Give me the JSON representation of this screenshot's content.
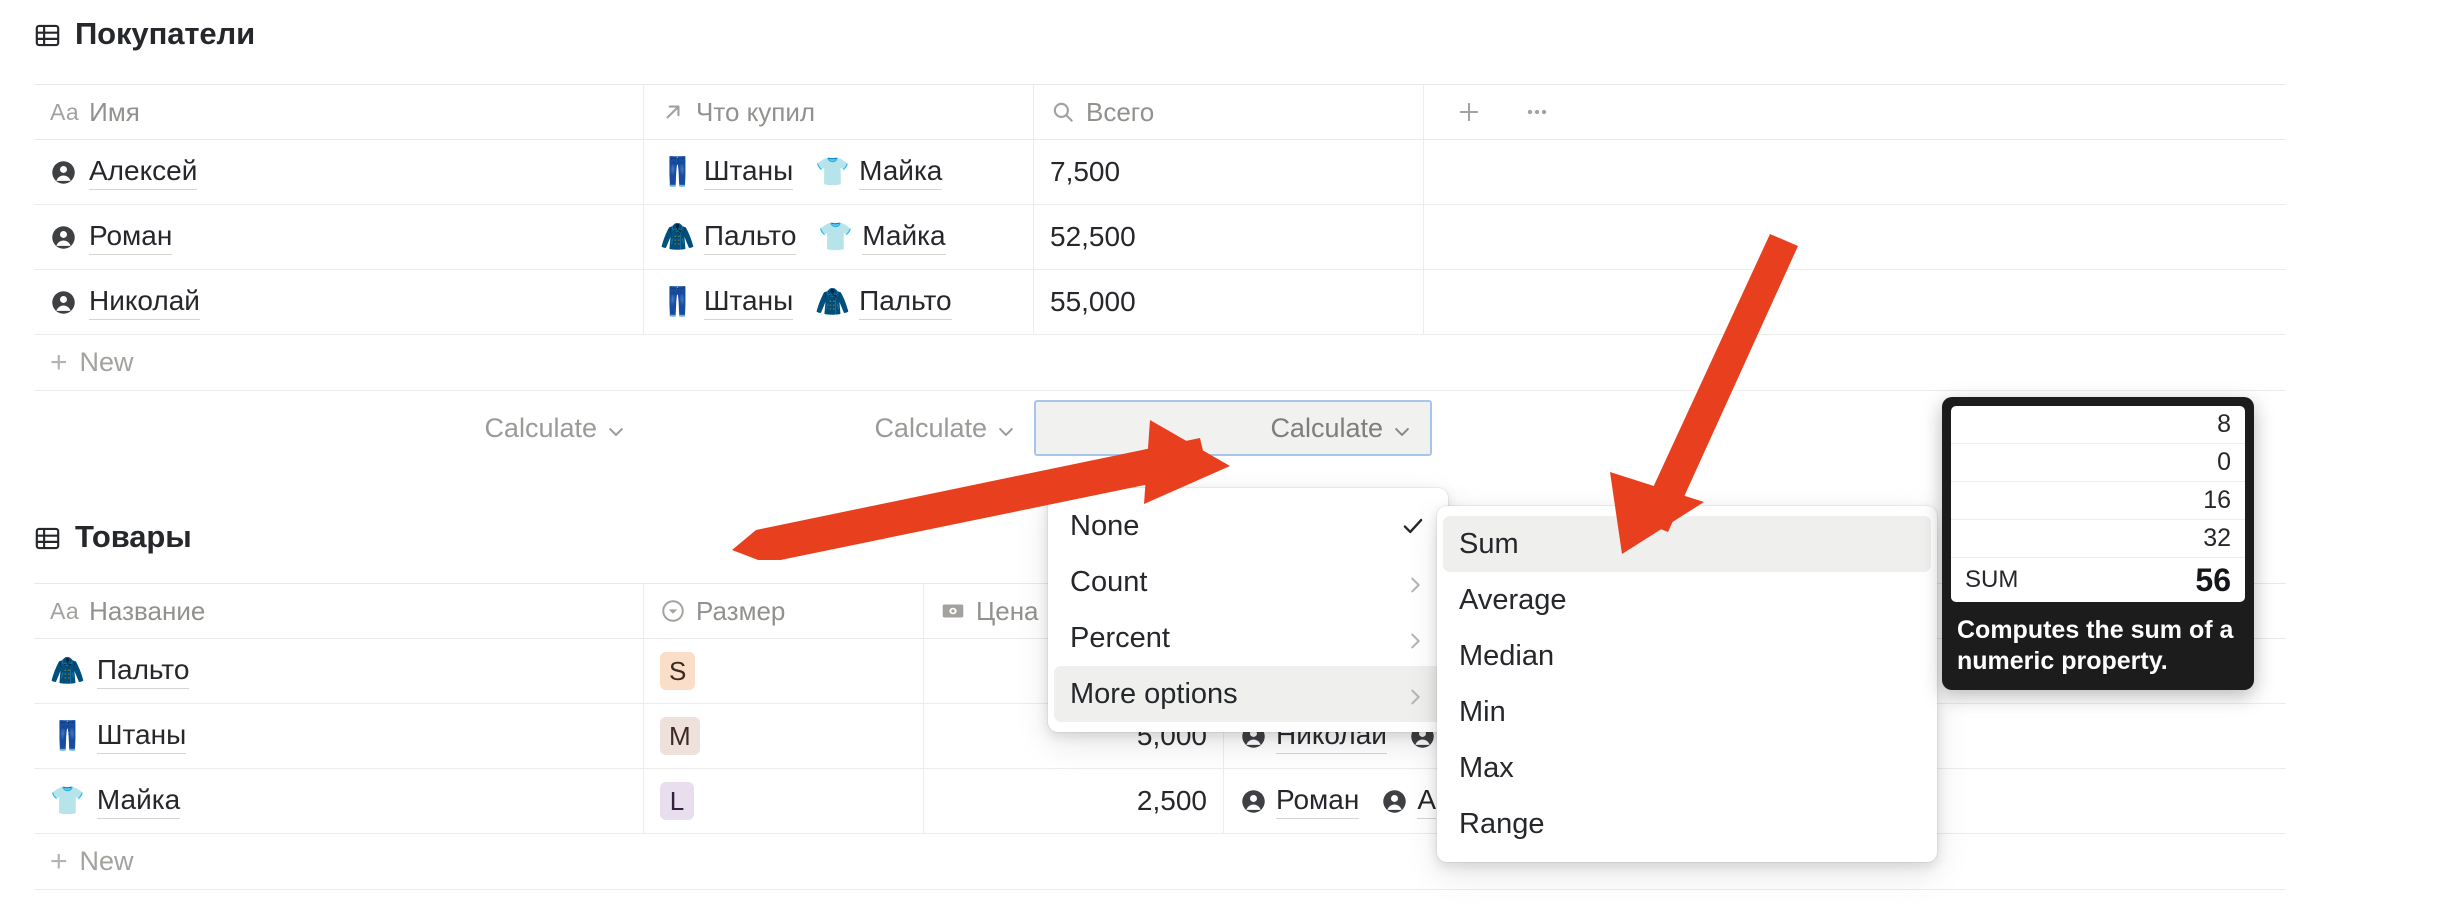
{
  "accent": {
    "arrow_red": "#e8401f",
    "selection_blue": "#a7c6ec",
    "menu_hover": "#efefee"
  },
  "buyers_db": {
    "title": "Покупатели",
    "icon": "table-grid-icon",
    "columns": [
      {
        "label": "Имя",
        "icon": "title-aa-icon"
      },
      {
        "label": "Что купил",
        "icon": "relation-arrow-icon"
      },
      {
        "label": "Всего",
        "icon": "rollup-search-icon"
      }
    ],
    "add_column_label": "+",
    "more_label": "•••",
    "rows": [
      {
        "name": "Алексей",
        "bought": [
          {
            "emoji": "👖",
            "label": "Штаны"
          },
          {
            "emoji": "👕",
            "label": "Майка"
          }
        ],
        "total": "7,500"
      },
      {
        "name": "Роман",
        "bought": [
          {
            "emoji": "🧥",
            "label": "Пальто"
          },
          {
            "emoji": "👕",
            "label": "Майка"
          }
        ],
        "total": "52,500"
      },
      {
        "name": "Николай",
        "bought": [
          {
            "emoji": "👖",
            "label": "Штаны"
          },
          {
            "emoji": "🧥",
            "label": "Пальто"
          }
        ],
        "total": "55,000"
      }
    ],
    "new_row_label": "New",
    "calculate": [
      {
        "label": "Calculate",
        "active": false
      },
      {
        "label": "Calculate",
        "active": false
      },
      {
        "label": "Calculate",
        "active": true
      }
    ]
  },
  "products_db": {
    "title": "Товары",
    "icon": "table-grid-icon",
    "columns": [
      {
        "label": "Название",
        "icon": "title-aa-icon"
      },
      {
        "label": "Размер",
        "icon": "select-circle-icon"
      },
      {
        "label": "Цена",
        "icon": "money-icon"
      }
    ],
    "rows": [
      {
        "emoji": "🧥",
        "name": "Пальто",
        "size": "S",
        "size_tone": "s",
        "price": "",
        "buyers": []
      },
      {
        "emoji": "👖",
        "name": "Штаны",
        "size": "M",
        "size_tone": "m",
        "price": "5,000",
        "buyers": [
          {
            "name": "Николай"
          },
          {
            "name": "А"
          }
        ]
      },
      {
        "emoji": "👕",
        "name": "Майка",
        "size": "L",
        "size_tone": "l",
        "price": "2,500",
        "buyers": [
          {
            "name": "Роман"
          },
          {
            "name": "А"
          }
        ]
      }
    ],
    "new_row_label": "New"
  },
  "calc_menu": {
    "items": [
      {
        "label": "None",
        "checked": true,
        "submenu": false,
        "selected": false
      },
      {
        "label": "Count",
        "checked": false,
        "submenu": true,
        "selected": false
      },
      {
        "label": "Percent",
        "checked": false,
        "submenu": true,
        "selected": false
      },
      {
        "label": "More options",
        "checked": false,
        "submenu": true,
        "selected": true
      }
    ]
  },
  "more_options_submenu": {
    "items": [
      {
        "label": "Sum",
        "selected": true
      },
      {
        "label": "Average",
        "selected": false
      },
      {
        "label": "Median",
        "selected": false
      },
      {
        "label": "Min",
        "selected": false
      },
      {
        "label": "Max",
        "selected": false
      },
      {
        "label": "Range",
        "selected": false
      }
    ]
  },
  "tooltip": {
    "preview_values": [
      "8",
      "0",
      "16",
      "32"
    ],
    "sum_label": "SUM",
    "sum_value": "56",
    "description": "Computes the sum of a numeric property."
  }
}
